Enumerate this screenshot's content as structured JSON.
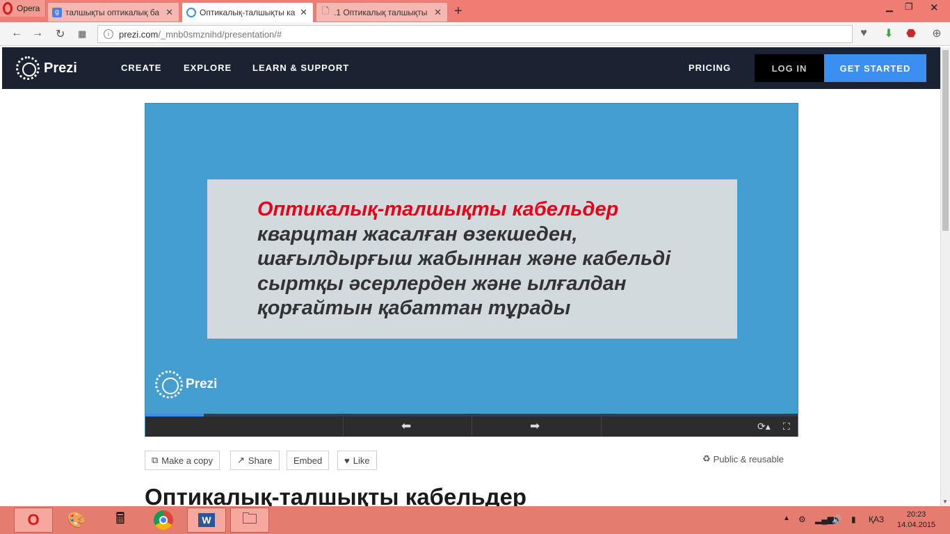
{
  "browser": {
    "opera_label": "Opera",
    "tabs": [
      {
        "title": "талшықты оптикалық ба",
        "favicon": "google-icon"
      },
      {
        "title": "Оптикалық-талшықты ка",
        "favicon": "prezi-icon"
      },
      {
        "title": ".1 Оптикалық талшықты",
        "favicon": "document-icon"
      }
    ],
    "new_tab_glyph": "+",
    "url_domain": "prezi.com",
    "url_path": "/_mnb0smznihd/presentation/#"
  },
  "header": {
    "logo_text": "Prezi",
    "nav": [
      "CREATE",
      "EXPLORE",
      "LEARN & SUPPORT"
    ],
    "pricing": "PRICING",
    "login": "LOG IN",
    "get_started": "GET STARTED"
  },
  "slide": {
    "highlight": "Оптикалық-талшықты кабельдер",
    "body": "кварцтан жасалған өзекшеден, шағылдырғыш жабыннан және кабельді сыртқы әсерлерден және ылғалдан қорғайтын қабаттан тұрады",
    "watermark": "Prezi",
    "progress": 0.09
  },
  "actions": {
    "make_copy": "Make a copy",
    "share": "Share",
    "embed": "Embed",
    "like": "Like",
    "public": "Public & reusable"
  },
  "page_title": "Оптикалық-талшықты кабельдер",
  "taskbar": {
    "language": "ҚАЗ",
    "time": "20:23",
    "date": "14.04.2015"
  },
  "colors": {
    "header_bg": "#1b2333",
    "get_started": "#3a8ff0",
    "slide_bg": "#449ecf",
    "slide_card": "#d2dadd",
    "highlight_text": "#e8001b",
    "tabstrip": "#f07d73"
  }
}
